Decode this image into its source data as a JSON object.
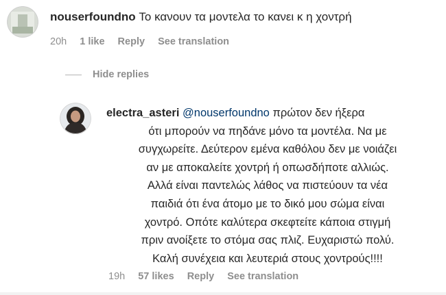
{
  "comments": [
    {
      "username": "nouserfoundno",
      "text": "Το κανουν τα μοντελα το κανει κ η χοντρή",
      "time": "20h",
      "likes": "1 like",
      "reply_label": "Reply",
      "translate_label": "See translation"
    },
    {
      "username": "electra_asteri",
      "mention": "@nouserfoundno",
      "lines": [
        "πρώτον δεν ήξερα",
        "ότι μπορούν να πηδάνε μόνο τα μοντέλα. Να με",
        "συγχωρείτε. Δεύτερον εμένα καθόλου δεν με νοιάζει",
        "αν με αποκαλείτε χοντρή ή οπωσδήποτε αλλιώς.",
        "Αλλά είναι παντελώς λάθος να πιστεύουν τα νέα",
        "παιδιά ότι ένα άτομο με το δικό μου σώμα είναι",
        "χοντρό. Οπότε καλύτερα σκεφτείτε κάποια στιγμή",
        "πριν ανοίξετε το στόμα σας πλιζ. Ευχαριστώ πολύ.",
        "Καλή συνέχεια και λευτεριά στους χοντρούς!!!!"
      ],
      "time": "19h",
      "likes": "57 likes",
      "reply_label": "Reply",
      "translate_label": "See translation"
    }
  ],
  "hide_replies_label": "Hide replies",
  "colors": {
    "text": "#262626",
    "meta": "#8e8e8e",
    "mention": "#00376b"
  }
}
